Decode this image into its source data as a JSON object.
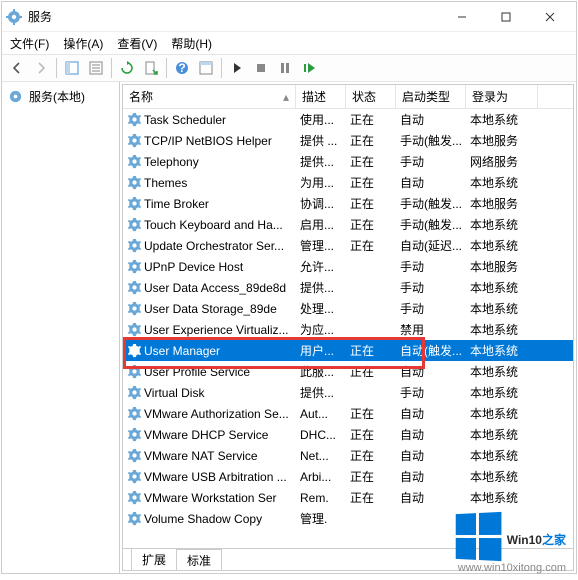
{
  "window": {
    "title": "服务"
  },
  "menu": {
    "file": "文件(F)",
    "action": "操作(A)",
    "view": "查看(V)",
    "help": "帮助(H)"
  },
  "tree": {
    "root": "服务(本地)"
  },
  "columns": {
    "name": "名称",
    "desc": "描述",
    "status": "状态",
    "startup": "启动类型",
    "logon": "登录为"
  },
  "tabs": {
    "ext": "扩展",
    "std": "标准"
  },
  "watermark": {
    "brand1": "Win10",
    "brand2": "之家",
    "url": "www.win10xitong.com"
  },
  "rows": [
    {
      "name": "Task Scheduler",
      "desc": "使用...",
      "status": "正在",
      "startup": "自动",
      "logon": "本地系统"
    },
    {
      "name": "TCP/IP NetBIOS Helper",
      "desc": "提供 ...",
      "status": "正在",
      "startup": "手动(触发...",
      "logon": "本地服务"
    },
    {
      "name": "Telephony",
      "desc": "提供...",
      "status": "正在",
      "startup": "手动",
      "logon": "网络服务"
    },
    {
      "name": "Themes",
      "desc": "为用...",
      "status": "正在",
      "startup": "自动",
      "logon": "本地系统"
    },
    {
      "name": "Time Broker",
      "desc": "协调...",
      "status": "正在",
      "startup": "手动(触发...",
      "logon": "本地服务"
    },
    {
      "name": "Touch Keyboard and Ha...",
      "desc": "启用...",
      "status": "正在",
      "startup": "手动(触发...",
      "logon": "本地系统"
    },
    {
      "name": "Update Orchestrator Ser...",
      "desc": "管理...",
      "status": "正在",
      "startup": "自动(延迟...",
      "logon": "本地系统"
    },
    {
      "name": "UPnP Device Host",
      "desc": "允许...",
      "status": "",
      "startup": "手动",
      "logon": "本地服务"
    },
    {
      "name": "User Data Access_89de8d",
      "desc": "提供...",
      "status": "",
      "startup": "手动",
      "logon": "本地系统"
    },
    {
      "name": "User Data Storage_89de",
      "desc": "处理...",
      "status": "",
      "startup": "手动",
      "logon": "本地系统"
    },
    {
      "name": "User Experience Virtualiz...",
      "desc": "为应...",
      "status": "",
      "startup": "禁用",
      "logon": "本地系统"
    },
    {
      "name": "User Manager",
      "desc": "用户...",
      "status": "正在",
      "startup": "自动(触发...",
      "logon": "本地系统",
      "selected": true
    },
    {
      "name": "User Profile Service",
      "desc": "此服...",
      "status": "正在",
      "startup": "自动",
      "logon": "本地系统"
    },
    {
      "name": "Virtual Disk",
      "desc": "提供...",
      "status": "",
      "startup": "手动",
      "logon": "本地系统"
    },
    {
      "name": "VMware Authorization Se...",
      "desc": "Aut...",
      "status": "正在",
      "startup": "自动",
      "logon": "本地系统"
    },
    {
      "name": "VMware DHCP Service",
      "desc": "DHC...",
      "status": "正在",
      "startup": "自动",
      "logon": "本地系统"
    },
    {
      "name": "VMware NAT Service",
      "desc": "Net...",
      "status": "正在",
      "startup": "自动",
      "logon": "本地系统"
    },
    {
      "name": "VMware USB Arbitration ...",
      "desc": "Arbi...",
      "status": "正在",
      "startup": "自动",
      "logon": "本地系统"
    },
    {
      "name": "VMware Workstation Ser",
      "desc": "Rem.",
      "status": "正在",
      "startup": "自动",
      "logon": "本地系统"
    },
    {
      "name": "Volume Shadow Copy",
      "desc": "管理.",
      "status": "",
      "startup": "",
      "logon": ""
    }
  ]
}
